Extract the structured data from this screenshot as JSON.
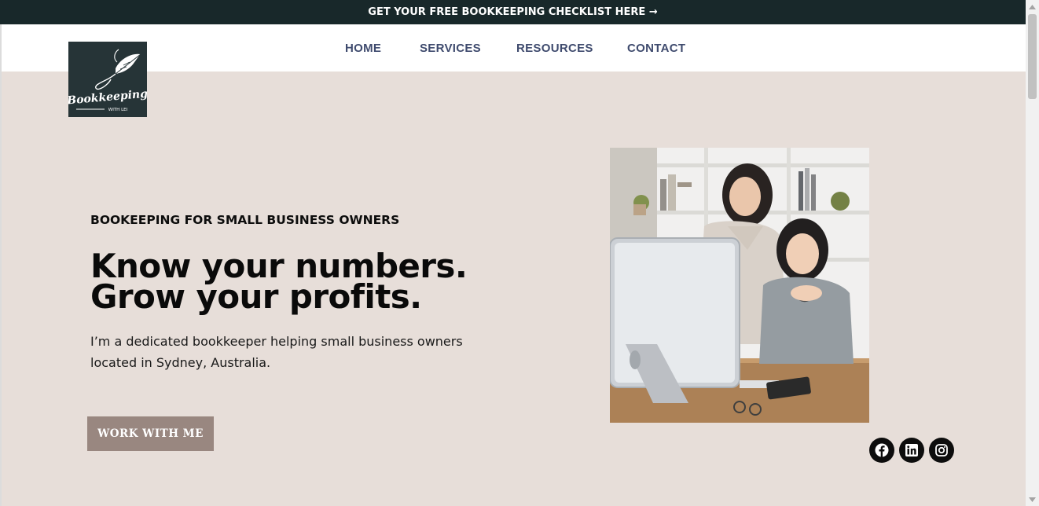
{
  "announcement": {
    "text": "GET YOUR FREE BOOKKEEPING CHECKLIST HERE →"
  },
  "logo": {
    "wordmark": "Bookkeeping",
    "tagline": "WITH LEI",
    "icon": "quill-feather-icon"
  },
  "nav": {
    "items": [
      {
        "label": "HOME"
      },
      {
        "label": "SERVICES"
      },
      {
        "label": "RESOURCES"
      },
      {
        "label": "CONTACT"
      }
    ]
  },
  "hero": {
    "eyebrow": "BOOKEEPING FOR SMALL BUSINESS OWNERS",
    "headline_line1": "Know your numbers.",
    "headline_line2": "Grow your profits.",
    "intro": "I’m a dedicated bookkeeper helping small business owners located in Sydney, Australia.",
    "cta_label": "WORK WITH ME",
    "photo": "two-women-at-computer-photo"
  },
  "social": [
    {
      "icon": "facebook-icon"
    },
    {
      "icon": "linkedin-icon"
    },
    {
      "icon": "instagram-icon"
    }
  ],
  "colors": {
    "announcement_bg": "#18282a",
    "logo_bg": "#263437",
    "nav_text": "#3f4b6e",
    "hero_bg": "#e7ded9",
    "cta_bg": "#998780"
  }
}
